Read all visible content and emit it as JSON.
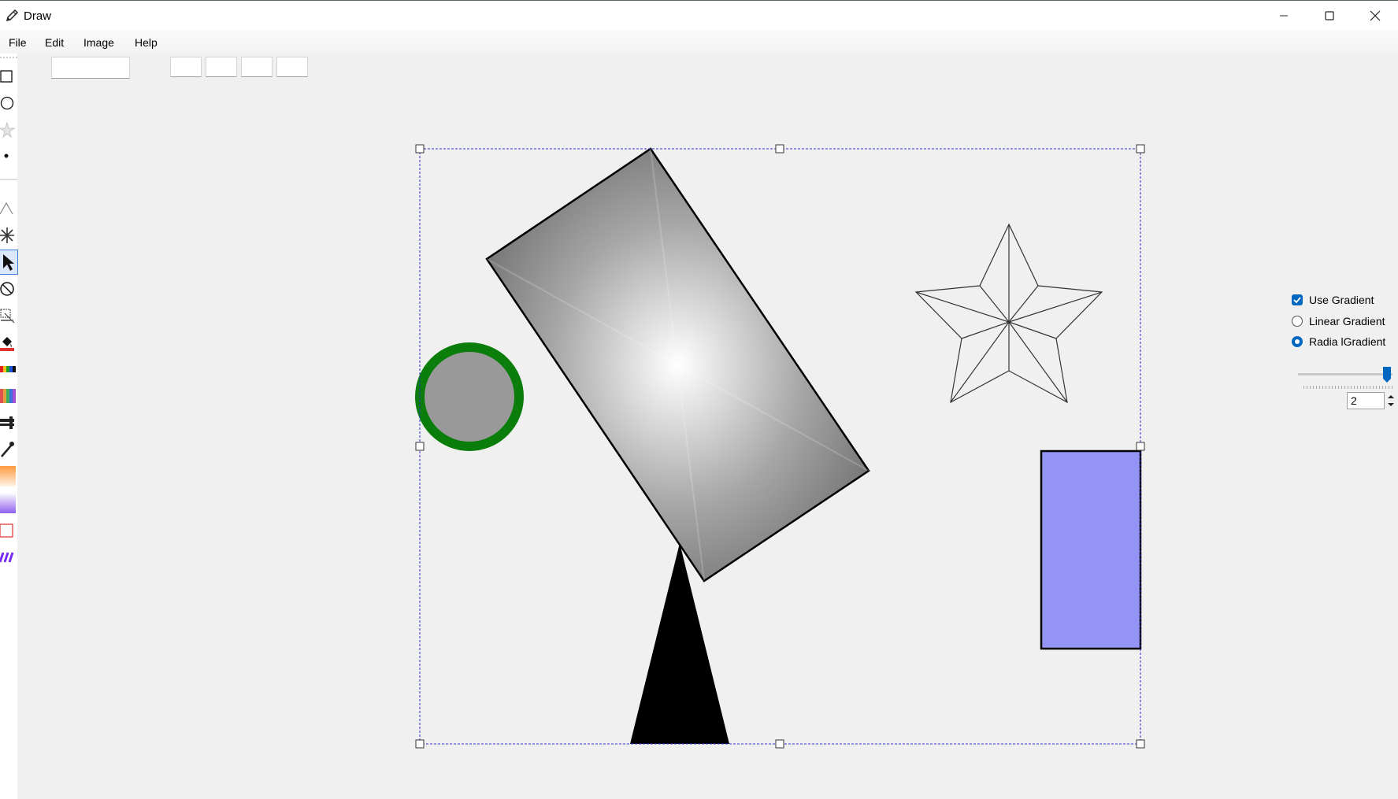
{
  "window": {
    "title": "Draw",
    "title_icon": "pencil-icon",
    "controls": [
      "minimize-icon",
      "maximize-icon",
      "close-icon"
    ]
  },
  "menu": {
    "items": [
      "File",
      "Edit",
      "Image",
      "Help"
    ]
  },
  "toolbox": {
    "tools": [
      {
        "name": "rectangle-tool-icon",
        "selected": false
      },
      {
        "name": "ellipse-tool-icon",
        "selected": false
      },
      {
        "name": "star-tool-icon",
        "selected": false
      },
      {
        "name": "point-tool-icon",
        "selected": false
      },
      {
        "name": "triangle-tool-icon",
        "selected": false
      },
      {
        "name": "snowflake-tool-icon",
        "selected": false
      },
      {
        "name": "select-pointer-icon",
        "selected": true
      },
      {
        "name": "rotate-tool-icon",
        "selected": false
      },
      {
        "name": "scale-tool-icon",
        "selected": false
      },
      {
        "name": "fill-bucket-icon",
        "selected": false
      },
      {
        "name": "color-strip-icon",
        "selected": false
      },
      {
        "name": "color-palette-icon",
        "selected": false
      },
      {
        "name": "pen-width-icon",
        "selected": false
      },
      {
        "name": "eyedropper-icon",
        "selected": false
      },
      {
        "name": "orange-gradient-swatch-icon",
        "selected": false
      },
      {
        "name": "purple-gradient-swatch-icon",
        "selected": false
      },
      {
        "name": "red-outline-swatch-icon",
        "selected": false
      },
      {
        "name": "purple-pattern-swatch-icon",
        "selected": false
      }
    ]
  },
  "toolbar_fields": {
    "text_field": "",
    "color_fields": [
      "",
      "",
      "",
      ""
    ]
  },
  "canvas": {
    "shapes": [
      {
        "type": "circle",
        "fill": "#999999",
        "stroke": "#0a7d0a"
      },
      {
        "type": "rotated-rectangle",
        "fill": "radial-gradient",
        "gradient_colors": [
          "#ffffff",
          "#6e6e6e"
        ],
        "stroke": "#000000"
      },
      {
        "type": "triangle",
        "fill": "#000000"
      },
      {
        "type": "star",
        "fill": "none",
        "stroke": "#333333"
      },
      {
        "type": "rectangle",
        "fill": "#9494f4",
        "stroke": "#000000"
      }
    ],
    "selection_color": "#3030cc"
  },
  "options": {
    "use_gradient": {
      "label": "Use Gradient",
      "checked": true
    },
    "linear_gradient": {
      "label": "Linear Gradient",
      "selected": false
    },
    "radial_gradient": {
      "label": "Radia lGradient",
      "selected": true
    },
    "slider_level": 1.0,
    "spin_value": "2"
  },
  "colors": {
    "accent": "#0067c0",
    "window_bg": "#f0f0f0"
  }
}
